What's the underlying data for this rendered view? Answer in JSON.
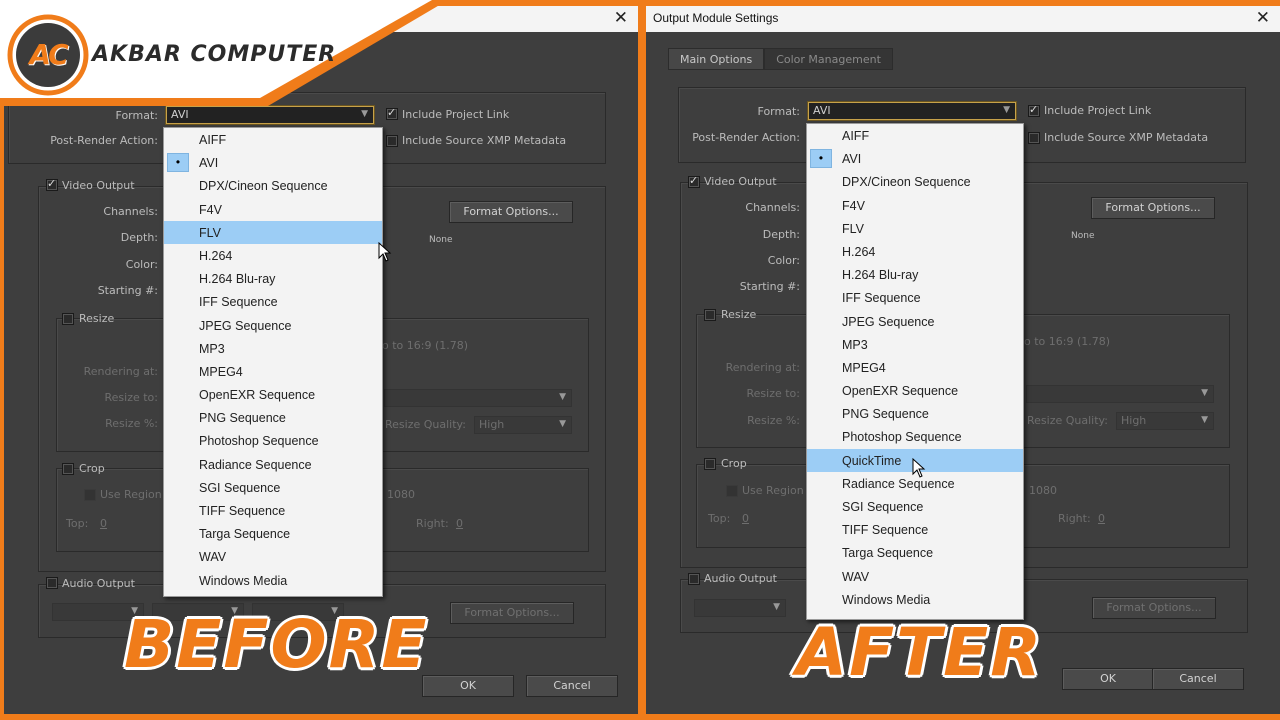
{
  "colors": {
    "frame": "#f07c1a",
    "dialog_bg": "#3e3e3e",
    "menu_highlight": "#9ccdf5",
    "focus_border": "#c7a24a"
  },
  "logo": {
    "initials": "AC",
    "name": "AKBAR COMPUTER"
  },
  "captions": {
    "before": "BEFORE",
    "after": "AFTER"
  },
  "left": {
    "format_value": "AVI",
    "include_project_link": "Include Project Link",
    "include_xmp": "Include Source XMP Metadata",
    "format_label": "Format:",
    "post_render_label": "Post-Render Action:",
    "video_output": "Video Output",
    "channels": "Channels:",
    "depth": "Depth:",
    "color": "Color:",
    "starting": "Starting #:",
    "format_options": "Format Options...",
    "none_text": "None",
    "resize": "Resize",
    "aspect": "o to 16:9 (1.78)",
    "rendering_at": "Rendering at:",
    "resize_to": "Resize to:",
    "resize_pct": "Resize %:",
    "resize_quality": "Resize Quality:",
    "quality_value": "High",
    "crop": "Crop",
    "use_region": "Use Region",
    "region_val": "1080",
    "top": "Top:",
    "top_val": "0",
    "right": "Right:",
    "right_val": "0",
    "audio_output": "Audio Output",
    "audio_format_options": "Format Options...",
    "ok": "OK",
    "cancel": "Cancel",
    "menu": [
      "AIFF",
      "AVI",
      "DPX/Cineon Sequence",
      "F4V",
      "FLV",
      "H.264",
      "H.264 Blu-ray",
      "IFF Sequence",
      "JPEG Sequence",
      "MP3",
      "MPEG4",
      "OpenEXR Sequence",
      "PNG Sequence",
      "Photoshop Sequence",
      "Radiance Sequence",
      "SGI Sequence",
      "TIFF Sequence",
      "Targa Sequence",
      "WAV",
      "Windows Media"
    ],
    "selected": "AVI",
    "hovered": "FLV"
  },
  "right": {
    "title": "Output Module Settings",
    "tabs": [
      "Main Options",
      "Color Management"
    ],
    "format_value": "AVI",
    "include_project_link": "Include Project Link",
    "include_xmp": "Include Source XMP Metadata",
    "format_label": "Format:",
    "post_render_label": "Post-Render Action:",
    "video_output": "Video Output",
    "channels": "Channels:",
    "depth": "Depth:",
    "color": "Color:",
    "starting": "Starting #:",
    "format_options": "Format Options...",
    "none_text": "None",
    "resize": "Resize",
    "aspect": "o to 16:9 (1.78)",
    "rendering_at": "Rendering at:",
    "resize_to": "Resize to:",
    "resize_pct": "Resize %:",
    "resize_quality": "Resize Quality:",
    "quality_value": "High",
    "crop": "Crop",
    "use_region": "Use Region",
    "region_val": "1080",
    "top": "Top:",
    "top_val": "0",
    "right": "Right:",
    "right_val": "0",
    "audio_output": "Audio Output",
    "audio_format_options": "Format Options...",
    "ok": "OK",
    "cancel": "Cancel",
    "menu": [
      "AIFF",
      "AVI",
      "DPX/Cineon Sequence",
      "F4V",
      "FLV",
      "H.264",
      "H.264 Blu-ray",
      "IFF Sequence",
      "JPEG Sequence",
      "MP3",
      "MPEG4",
      "OpenEXR Sequence",
      "PNG Sequence",
      "Photoshop Sequence",
      "QuickTime",
      "Radiance Sequence",
      "SGI Sequence",
      "TIFF Sequence",
      "Targa Sequence",
      "WAV",
      "Windows Media"
    ],
    "selected": "AVI",
    "hovered": "QuickTime"
  }
}
